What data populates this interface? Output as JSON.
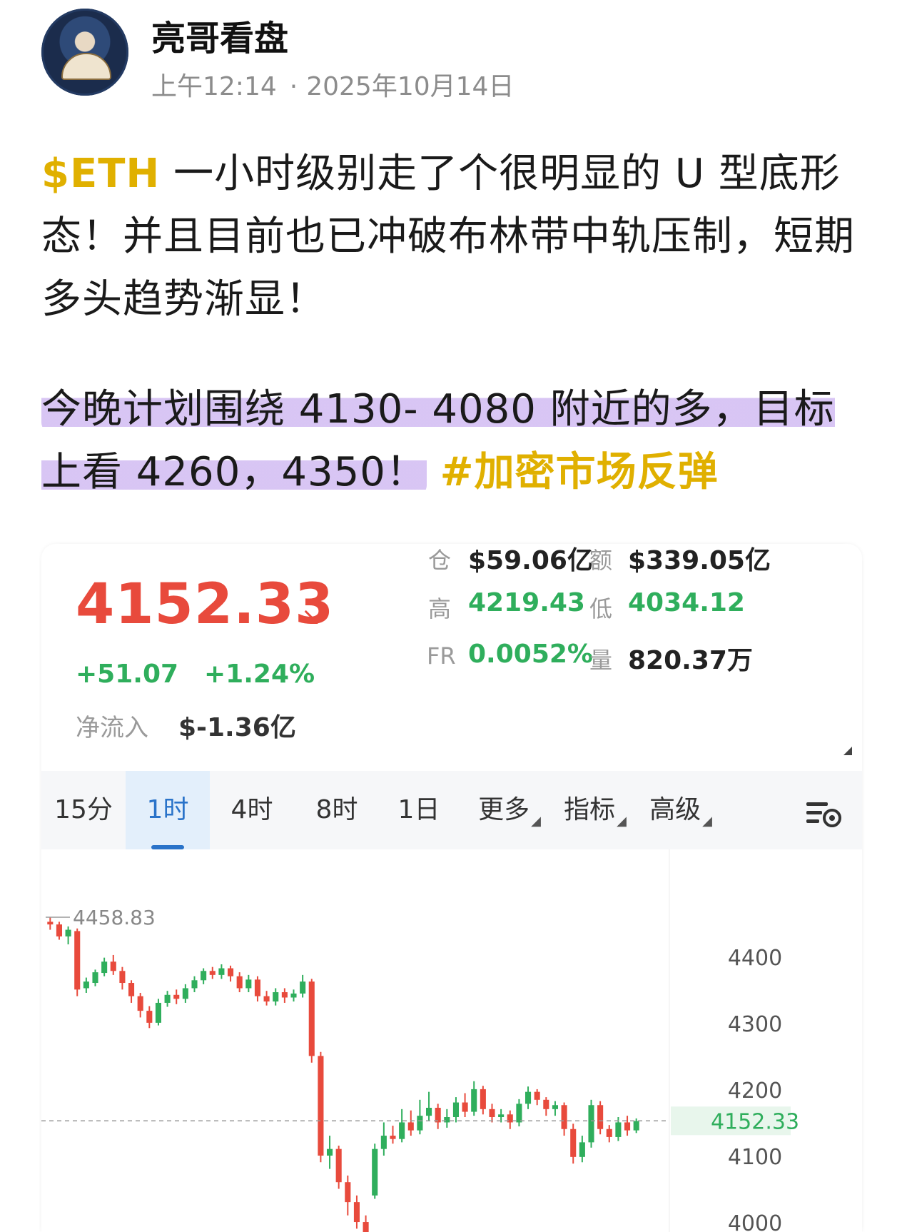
{
  "header": {
    "author": "亮哥看盘",
    "time": "上午12:14",
    "dot": "·",
    "date": "2025年10月14日"
  },
  "post": {
    "cashtag": "$ETH",
    "p1_text": " 一小时级别走了个很明显的 U 型底形态！并且目前也已冲破布林带中轨压制，短期多头趋势渐显！",
    "p2_text": "今晚计划围绕 4130- 4080 附近的多，目标上看 4260，4350！",
    "hashtag": "#加密市场反弹"
  },
  "ticker": {
    "price": "4152.33",
    "arrow": "↘",
    "change": "+51.07",
    "change_pct": "+1.24%",
    "net_inflow_label": "净流入",
    "net_inflow_value": "$-1.36亿",
    "stats": {
      "oi_label": "仓",
      "oi_value": "$59.06亿",
      "amount_label": "额",
      "amount_value": "$339.05亿",
      "high_label": "高",
      "high_value": "4219.43",
      "low_label": "低",
      "low_value": "4034.12",
      "fr_label": "FR",
      "fr_value": "0.0052%",
      "vol_label": "量",
      "vol_value": "820.37万"
    },
    "colors": {
      "up": "#2fae5c",
      "down": "#e84a3c",
      "accent": "#2a73c9",
      "tag": "#e0b000"
    }
  },
  "tabs": [
    {
      "label": "15分",
      "caret": ""
    },
    {
      "label": "1时",
      "caret": "",
      "active": true
    },
    {
      "label": "4时",
      "caret": ""
    },
    {
      "label": "8时",
      "caret": ""
    },
    {
      "label": "1日",
      "caret": ""
    },
    {
      "label": "更多",
      "caret": "◢"
    },
    {
      "label": "指标",
      "caret": "◢"
    },
    {
      "label": "高级",
      "caret": "◢"
    }
  ],
  "icons": {
    "settings": "chart-settings-icon"
  },
  "chart_data": {
    "type": "candlestick",
    "interval": "1时",
    "y_ticks": [
      4400,
      4300,
      4200,
      4100,
      4000
    ],
    "ylim": [
      3985,
      4475
    ],
    "current_price": 4152.33,
    "current_price_label": "4152.33",
    "max_marker": 4458.83,
    "max_marker_label": "4458.83",
    "candles": [
      [
        4452,
        4448,
        4459,
        4440
      ],
      [
        4448,
        4430,
        4452,
        4425
      ],
      [
        4430,
        4440,
        4445,
        4418
      ],
      [
        4438,
        4350,
        4442,
        4340
      ],
      [
        4352,
        4362,
        4368,
        4345
      ],
      [
        4360,
        4376,
        4380,
        4355
      ],
      [
        4375,
        4392,
        4398,
        4370
      ],
      [
        4392,
        4378,
        4402,
        4372
      ],
      [
        4378,
        4360,
        4384,
        4350
      ],
      [
        4360,
        4340,
        4364,
        4330
      ],
      [
        4340,
        4318,
        4345,
        4308
      ],
      [
        4318,
        4300,
        4325,
        4292
      ],
      [
        4300,
        4330,
        4336,
        4296
      ],
      [
        4330,
        4342,
        4348,
        4324
      ],
      [
        4342,
        4336,
        4350,
        4328
      ],
      [
        4336,
        4352,
        4358,
        4330
      ],
      [
        4352,
        4364,
        4370,
        4346
      ],
      [
        4364,
        4378,
        4382,
        4358
      ],
      [
        4378,
        4372,
        4384,
        4366
      ],
      [
        4372,
        4382,
        4388,
        4366
      ],
      [
        4382,
        4370,
        4386,
        4362
      ],
      [
        4370,
        4352,
        4376,
        4346
      ],
      [
        4352,
        4365,
        4372,
        4346
      ],
      [
        4365,
        4340,
        4370,
        4332
      ],
      [
        4340,
        4332,
        4348,
        4326
      ],
      [
        4332,
        4346,
        4352,
        4326
      ],
      [
        4346,
        4338,
        4352,
        4330
      ],
      [
        4338,
        4344,
        4350,
        4332
      ],
      [
        4344,
        4362,
        4372,
        4338
      ],
      [
        4362,
        4250,
        4366,
        4240
      ],
      [
        4250,
        4100,
        4256,
        4090
      ],
      [
        4100,
        4110,
        4130,
        4080
      ],
      [
        4110,
        4060,
        4115,
        4050
      ],
      [
        4060,
        4030,
        4070,
        4010
      ],
      [
        4030,
        4000,
        4040,
        3990
      ],
      [
        4000,
        3980,
        4010,
        3975
      ],
      [
        4040,
        4110,
        4118,
        4035
      ],
      [
        4110,
        4130,
        4150,
        4100
      ],
      [
        4130,
        4125,
        4145,
        4118
      ],
      [
        4125,
        4150,
        4170,
        4120
      ],
      [
        4150,
        4138,
        4168,
        4130
      ],
      [
        4138,
        4160,
        4184,
        4132
      ],
      [
        4160,
        4172,
        4196,
        4152
      ],
      [
        4172,
        4150,
        4178,
        4140
      ],
      [
        4150,
        4158,
        4170,
        4142
      ],
      [
        4158,
        4180,
        4188,
        4150
      ],
      [
        4180,
        4166,
        4194,
        4158
      ],
      [
        4166,
        4200,
        4212,
        4160
      ],
      [
        4200,
        4170,
        4205,
        4162
      ],
      [
        4170,
        4158,
        4178,
        4150
      ],
      [
        4158,
        4162,
        4170,
        4150
      ],
      [
        4162,
        4150,
        4168,
        4140
      ],
      [
        4150,
        4178,
        4185,
        4144
      ],
      [
        4178,
        4196,
        4204,
        4170
      ],
      [
        4196,
        4184,
        4200,
        4176
      ],
      [
        4184,
        4170,
        4188,
        4160
      ],
      [
        4170,
        4176,
        4182,
        4160
      ],
      [
        4176,
        4140,
        4180,
        4130
      ],
      [
        4140,
        4098,
        4148,
        4088
      ],
      [
        4098,
        4120,
        4130,
        4090
      ],
      [
        4120,
        4176,
        4184,
        4112
      ],
      [
        4176,
        4140,
        4182,
        4132
      ],
      [
        4140,
        4128,
        4146,
        4120
      ],
      [
        4128,
        4150,
        4158,
        4122
      ],
      [
        4150,
        4138,
        4160,
        4130
      ],
      [
        4138,
        4152,
        4156,
        4134
      ]
    ]
  }
}
